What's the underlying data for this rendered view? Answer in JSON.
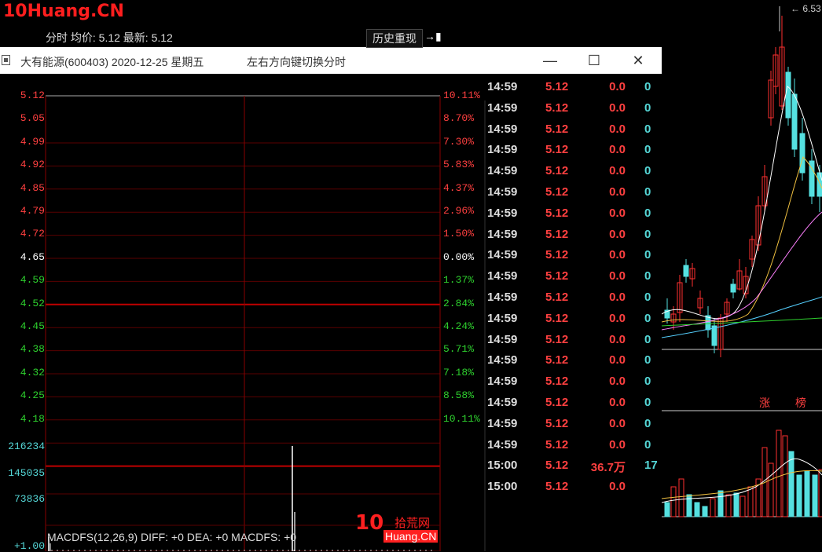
{
  "site_logo": "10Huang.CN",
  "kline": {
    "top_price_label": "6.53",
    "zhang": "涨",
    "bang": "榜",
    "colors": {
      "up": "#ff3030",
      "down": "#55e0e0"
    }
  },
  "window": {
    "title": "大有能源(600403) 2020-12-25 星期五",
    "hint": "左右方向键切换分时",
    "minimize": "—",
    "maximize": "☐",
    "close": "✕"
  },
  "chart": {
    "header": "分时 均价: 5.12 最新: 5.12",
    "replay_label": "历史重现",
    "replay_icon": "→▮",
    "price_ticks": [
      "5.12",
      "5.05",
      "4.99",
      "4.92",
      "4.85",
      "4.79",
      "4.72",
      "4.65",
      "4.59",
      "4.52",
      "4.45",
      "4.38",
      "4.32",
      "4.25",
      "4.18"
    ],
    "pct_ticks": [
      "10.11%",
      "8.70%",
      "7.30%",
      "5.83%",
      "4.37%",
      "2.96%",
      "1.50%",
      "0.00%",
      "1.37%",
      "2.84%",
      "4.24%",
      "5.71%",
      "7.18%",
      "8.58%",
      "10.11%"
    ],
    "volume_ticks": [
      "216234",
      "145035",
      "73836"
    ],
    "macd_bottom_tick": "+1.00",
    "macd_label": "MACDFS(12,26,9) DIFF: +0 DEA: +0 MACDFS: +0"
  },
  "trades": [
    {
      "time": "14:59",
      "price": "5.12",
      "vol": "0.0",
      "extra": "0"
    },
    {
      "time": "14:59",
      "price": "5.12",
      "vol": "0.0",
      "extra": "0"
    },
    {
      "time": "14:59",
      "price": "5.12",
      "vol": "0.0",
      "extra": "0"
    },
    {
      "time": "14:59",
      "price": "5.12",
      "vol": "0.0",
      "extra": "0"
    },
    {
      "time": "14:59",
      "price": "5.12",
      "vol": "0.0",
      "extra": "0"
    },
    {
      "time": "14:59",
      "price": "5.12",
      "vol": "0.0",
      "extra": "0"
    },
    {
      "time": "14:59",
      "price": "5.12",
      "vol": "0.0",
      "extra": "0"
    },
    {
      "time": "14:59",
      "price": "5.12",
      "vol": "0.0",
      "extra": "0"
    },
    {
      "time": "14:59",
      "price": "5.12",
      "vol": "0.0",
      "extra": "0"
    },
    {
      "time": "14:59",
      "price": "5.12",
      "vol": "0.0",
      "extra": "0"
    },
    {
      "time": "14:59",
      "price": "5.12",
      "vol": "0.0",
      "extra": "0"
    },
    {
      "time": "14:59",
      "price": "5.12",
      "vol": "0.0",
      "extra": "0"
    },
    {
      "time": "14:59",
      "price": "5.12",
      "vol": "0.0",
      "extra": "0"
    },
    {
      "time": "14:59",
      "price": "5.12",
      "vol": "0.0",
      "extra": "0"
    },
    {
      "time": "14:59",
      "price": "5.12",
      "vol": "0.0",
      "extra": "0"
    },
    {
      "time": "14:59",
      "price": "5.12",
      "vol": "0.0",
      "extra": "0"
    },
    {
      "time": "14:59",
      "price": "5.12",
      "vol": "0.0",
      "extra": "0"
    },
    {
      "time": "14:59",
      "price": "5.12",
      "vol": "0.0",
      "extra": "0"
    },
    {
      "time": "15:00",
      "price": "5.12",
      "vol": "36.7万",
      "extra": "17"
    },
    {
      "time": "15:00",
      "price": "5.12",
      "vol": "0.0",
      "extra": ""
    }
  ],
  "watermark": {
    "logo": "10",
    "text_cn": "拾荒网",
    "text_en": "Huang.CN"
  }
}
